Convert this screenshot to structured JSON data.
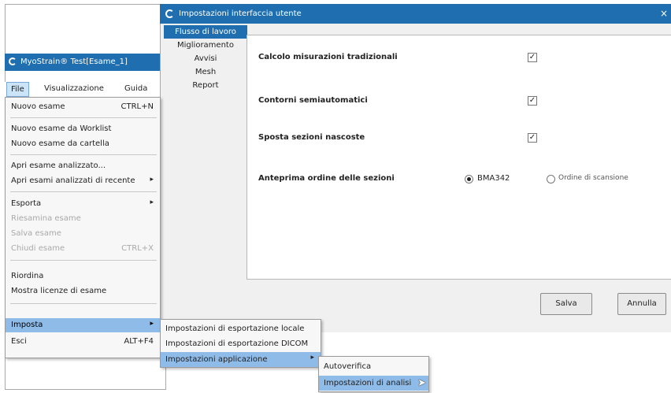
{
  "main_window": {
    "title": "MyoStrain® Test[Esame_1]"
  },
  "menubar": {
    "items": [
      "File",
      "Visualizzazione",
      "Guida"
    ]
  },
  "file_menu": {
    "items": [
      {
        "label": "Nuovo esame",
        "shortcut": "CTRL+N"
      },
      {
        "label": "Nuovo esame da Worklist"
      },
      {
        "label": "Nuovo esame da cartella"
      },
      {
        "label": "Apri esame analizzato..."
      },
      {
        "label": "Apri esami analizzati di recente",
        "arrow": "▸"
      },
      {
        "label": "Esporta",
        "arrow": "▸"
      },
      {
        "label": "Riesamina esame"
      },
      {
        "label": "Salva esame"
      },
      {
        "label": "Chiudi esame",
        "shortcut": "CTRL+X"
      },
      {
        "label": "Riordina"
      },
      {
        "label": "Mostra licenze di esame"
      },
      {
        "label": "Imposta",
        "arrow": "▸"
      },
      {
        "label": "Esci",
        "shortcut": "ALT+F4"
      }
    ]
  },
  "imposta_submenu": {
    "items": [
      {
        "label": "Impostazioni di esportazione locale"
      },
      {
        "label": "Impostazioni di esportazione DICOM"
      },
      {
        "label": "Impostazioni applicazione",
        "arrow": "▸"
      }
    ]
  },
  "app_settings_submenu": {
    "items": [
      {
        "label": "Autoverifica"
      },
      {
        "label": "Impostazioni di analisi"
      }
    ]
  },
  "dialog": {
    "title": "Impostazioni interfaccia utente",
    "close": "×",
    "categories": [
      "Flusso di lavoro",
      "Miglioramento",
      "Avvisi",
      "Mesh",
      "Report"
    ],
    "settings": {
      "calcolo": {
        "label": "Calcolo misurazioni tradizionali",
        "checked": true
      },
      "contorni": {
        "label": "Contorni semiautomatici",
        "checked": true
      },
      "sposta": {
        "label": "Sposta sezioni nascoste",
        "checked": true
      },
      "anteprima": {
        "label": "Anteprima ordine delle sezioni",
        "options": [
          "BMA342",
          "Ordine di scansione"
        ],
        "selected": "BMA342"
      }
    },
    "buttons": {
      "save": "Salva",
      "cancel": "Annulla"
    },
    "check_glyph": "✓"
  },
  "colors": {
    "accent": "#1f6fb0",
    "menu_highlight": "#8fbbe8"
  }
}
